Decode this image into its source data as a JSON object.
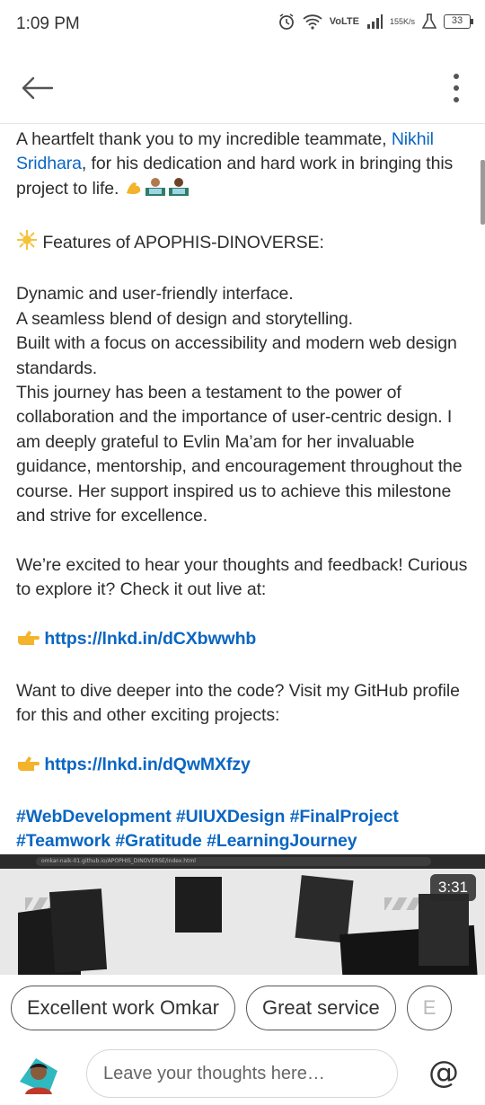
{
  "status_bar": {
    "time": "1:09 PM",
    "volte_top": "Vo",
    "volte_bottom": "LTE",
    "speed_value": "155",
    "speed_unit": "K/s",
    "battery": "33"
  },
  "header": {
    "back_icon": "arrow-left-icon",
    "more_icon": "more-vertical-icon"
  },
  "post": {
    "line_intro_1": "A heartfelt thank you to my incredible teammate,",
    "mention": "Nikhil Sridhara",
    "line_intro_2": ", for his dedication and hard work in bringing this project to life.",
    "features_heading": "Features of APOPHIS-DINOVERSE:",
    "paragraph_features": [
      "Dynamic and user-friendly interface.",
      "A seamless blend of design and storytelling.",
      "Built with a focus on accessibility and modern web design standards.",
      "This journey has been a testament to the power of collaboration and the importance of user-centric design. I am deeply grateful to Evlin Ma’am for her invaluable guidance, mentorship, and encouragement throughout the course. Her support inspired us to achieve this milestone and strive for excellence."
    ],
    "excited_text": "We’re excited to hear your thoughts and feedback! Curious to explore it? Check it out live at:",
    "link_1": "https://lnkd.in/dCXbwwhb",
    "github_text": "Want to dive deeper into the code? Visit my GitHub profile for this and other exciting projects:",
    "link_2": "https://lnkd.in/dQwMXfzy",
    "hashtags_line_1": "#WebDevelopment #UIUXDesign #FinalProject",
    "hashtags_line_2": "#Teamwork #Gratitude #LearningJourney"
  },
  "video": {
    "url": "omkar-naik-01.github.io/APOPHIS_DINOVERSE/index.html",
    "duration": "3:31"
  },
  "suggestions": [
    "Excellent work Omkar",
    "Great service",
    "E"
  ],
  "comment": {
    "placeholder": "Leave your thoughts here…",
    "mention_symbol": "@"
  },
  "colors": {
    "link": "#0a66c2",
    "text": "#2e2e2e"
  }
}
